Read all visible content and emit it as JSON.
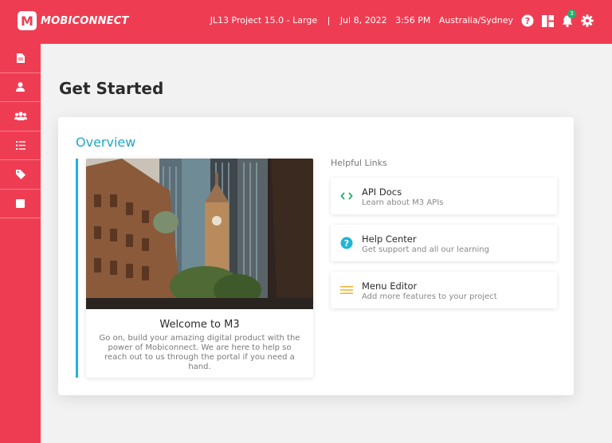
{
  "app": {
    "logo_letter": "M",
    "logo_text": "MOBICONNECT",
    "brand_color": "#ee3d53",
    "accent_color": "#22b4d4"
  },
  "header": {
    "project": "JL13 Project 15.0 - Large",
    "divider": "|",
    "date": "Jul 8, 2022",
    "time": "3:56 PM",
    "timezone": "Australia/Sydney",
    "icons": [
      "help-icon",
      "dashboard-layout-icon",
      "bell-icon",
      "gear-icon"
    ],
    "notification_count": "3"
  },
  "sidebar": {
    "items": [
      {
        "icon": "document-icon"
      },
      {
        "icon": "user-icon"
      },
      {
        "icon": "users-group-icon"
      },
      {
        "icon": "list-icon"
      },
      {
        "icon": "tag-icon"
      },
      {
        "icon": "square-icon"
      }
    ]
  },
  "main": {
    "title": "Get Started",
    "overview": {
      "title": "Overview",
      "welcome_title": "Welcome to M3",
      "welcome_text": "Go on, build your amazing digital product with the power of Mobiconnect. We are here to help so reach out to us through the portal if you need a hand."
    },
    "helpful_links": {
      "heading": "Helpful Links",
      "items": [
        {
          "title": "API Docs",
          "subtitle": "Learn about M3 APIs",
          "icon": "code-icon",
          "icon_color": "#20b16b"
        },
        {
          "title": "Help Center",
          "subtitle": "Get support and all our learning",
          "icon": "help-circle-icon",
          "icon_color": "#22b4d4"
        },
        {
          "title": "Menu Editor",
          "subtitle": "Add more features to your project",
          "icon": "menu-lines-icon",
          "icon_color": "#f0b43c"
        }
      ]
    }
  }
}
